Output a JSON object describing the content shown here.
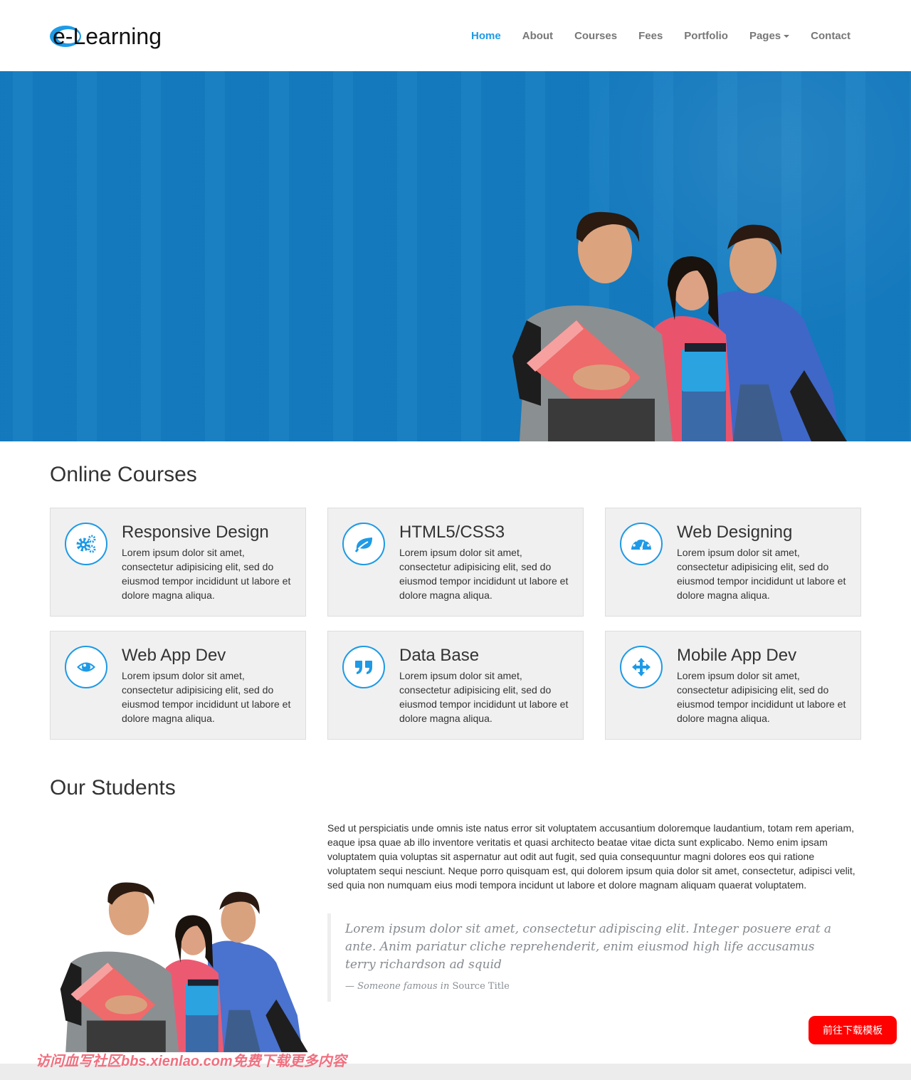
{
  "brand": {
    "logo_text": "e-Learning",
    "accent": "#1e9ae6"
  },
  "nav": {
    "items": [
      {
        "label": "Home",
        "active": true
      },
      {
        "label": "About"
      },
      {
        "label": "Courses"
      },
      {
        "label": "Fees"
      },
      {
        "label": "Portfolio"
      },
      {
        "label": "Pages",
        "dropdown": true
      },
      {
        "label": "Contact"
      }
    ]
  },
  "hero": {
    "background_color": "#157dc1",
    "image": "group-of-three-students-with-books"
  },
  "courses": {
    "title": "Online Courses",
    "items": [
      {
        "title": "Responsive Design",
        "icon": "cogs-icon",
        "text": "Lorem ipsum dolor sit amet, consectetur adipisicing elit, sed do eiusmod tempor incididunt ut labore et dolore magna aliqua."
      },
      {
        "title": "HTML5/CSS3",
        "icon": "leaf-icon",
        "text": "Lorem ipsum dolor sit amet, consectetur adipisicing elit, sed do eiusmod tempor incididunt ut labore et dolore magna aliqua."
      },
      {
        "title": "Web Designing",
        "icon": "dashboard-icon",
        "text": "Lorem ipsum dolor sit amet, consectetur adipisicing elit, sed do eiusmod tempor incididunt ut labore et dolore magna aliqua."
      },
      {
        "title": "Web App Dev",
        "icon": "eye-icon",
        "text": "Lorem ipsum dolor sit amet, consectetur adipisicing elit, sed do eiusmod tempor incididunt ut labore et dolore magna aliqua."
      },
      {
        "title": "Data Base",
        "icon": "quote-icon",
        "text": "Lorem ipsum dolor sit amet, consectetur adipisicing elit, sed do eiusmod tempor incididunt ut labore et dolore magna aliqua."
      },
      {
        "title": "Mobile App Dev",
        "icon": "move-arrows-icon",
        "text": "Lorem ipsum dolor sit amet, consectetur adipisicing elit, sed do eiusmod tempor incididunt ut labore et dolore magna aliqua."
      }
    ]
  },
  "students": {
    "title": "Our Students",
    "paragraph": "Sed ut perspiciatis unde omnis iste natus error sit voluptatem accusantium doloremque laudantium, totam rem aperiam, eaque ipsa quae ab illo inventore veritatis et quasi architecto beatae vitae dicta sunt explicabo. Nemo enim ipsam voluptatem quia voluptas sit aspernatur aut odit aut fugit, sed quia consequuntur magni dolores eos qui ratione voluptatem sequi nesciunt. Neque porro quisquam est, qui dolorem ipsum quia dolor sit amet, consectetur, adipisci velit, sed quia non numquam eius modi tempora incidunt ut labore et dolore magnam aliquam quaerat voluptatem.",
    "quote": {
      "text": "Lorem ipsum dolor sit amet, consectetur adipiscing elit. Integer posuere erat a ante. Anim pariatur cliche reprehenderit, enim eiusmod high life accusamus terry richardson ad squid",
      "attribution_prefix": "— Someone famous in",
      "source": "Source Title"
    }
  },
  "watermark": "访问血写社区bbs.xienlao.com免费下载更多内容",
  "download_button": {
    "label": "前往下载模板",
    "color": "#ff0000"
  }
}
